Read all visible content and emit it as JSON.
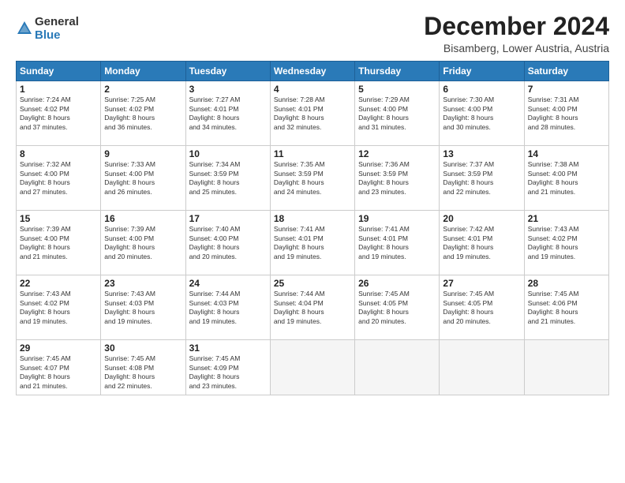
{
  "logo": {
    "general": "General",
    "blue": "Blue"
  },
  "title": "December 2024",
  "location": "Bisamberg, Lower Austria, Austria",
  "days_of_week": [
    "Sunday",
    "Monday",
    "Tuesday",
    "Wednesday",
    "Thursday",
    "Friday",
    "Saturday"
  ],
  "weeks": [
    [
      {
        "day": "1",
        "info": "Sunrise: 7:24 AM\nSunset: 4:02 PM\nDaylight: 8 hours\nand 37 minutes."
      },
      {
        "day": "2",
        "info": "Sunrise: 7:25 AM\nSunset: 4:02 PM\nDaylight: 8 hours\nand 36 minutes."
      },
      {
        "day": "3",
        "info": "Sunrise: 7:27 AM\nSunset: 4:01 PM\nDaylight: 8 hours\nand 34 minutes."
      },
      {
        "day": "4",
        "info": "Sunrise: 7:28 AM\nSunset: 4:01 PM\nDaylight: 8 hours\nand 32 minutes."
      },
      {
        "day": "5",
        "info": "Sunrise: 7:29 AM\nSunset: 4:00 PM\nDaylight: 8 hours\nand 31 minutes."
      },
      {
        "day": "6",
        "info": "Sunrise: 7:30 AM\nSunset: 4:00 PM\nDaylight: 8 hours\nand 30 minutes."
      },
      {
        "day": "7",
        "info": "Sunrise: 7:31 AM\nSunset: 4:00 PM\nDaylight: 8 hours\nand 28 minutes."
      }
    ],
    [
      {
        "day": "8",
        "info": "Sunrise: 7:32 AM\nSunset: 4:00 PM\nDaylight: 8 hours\nand 27 minutes."
      },
      {
        "day": "9",
        "info": "Sunrise: 7:33 AM\nSunset: 4:00 PM\nDaylight: 8 hours\nand 26 minutes."
      },
      {
        "day": "10",
        "info": "Sunrise: 7:34 AM\nSunset: 3:59 PM\nDaylight: 8 hours\nand 25 minutes."
      },
      {
        "day": "11",
        "info": "Sunrise: 7:35 AM\nSunset: 3:59 PM\nDaylight: 8 hours\nand 24 minutes."
      },
      {
        "day": "12",
        "info": "Sunrise: 7:36 AM\nSunset: 3:59 PM\nDaylight: 8 hours\nand 23 minutes."
      },
      {
        "day": "13",
        "info": "Sunrise: 7:37 AM\nSunset: 3:59 PM\nDaylight: 8 hours\nand 22 minutes."
      },
      {
        "day": "14",
        "info": "Sunrise: 7:38 AM\nSunset: 4:00 PM\nDaylight: 8 hours\nand 21 minutes."
      }
    ],
    [
      {
        "day": "15",
        "info": "Sunrise: 7:39 AM\nSunset: 4:00 PM\nDaylight: 8 hours\nand 21 minutes."
      },
      {
        "day": "16",
        "info": "Sunrise: 7:39 AM\nSunset: 4:00 PM\nDaylight: 8 hours\nand 20 minutes."
      },
      {
        "day": "17",
        "info": "Sunrise: 7:40 AM\nSunset: 4:00 PM\nDaylight: 8 hours\nand 20 minutes."
      },
      {
        "day": "18",
        "info": "Sunrise: 7:41 AM\nSunset: 4:01 PM\nDaylight: 8 hours\nand 19 minutes."
      },
      {
        "day": "19",
        "info": "Sunrise: 7:41 AM\nSunset: 4:01 PM\nDaylight: 8 hours\nand 19 minutes."
      },
      {
        "day": "20",
        "info": "Sunrise: 7:42 AM\nSunset: 4:01 PM\nDaylight: 8 hours\nand 19 minutes."
      },
      {
        "day": "21",
        "info": "Sunrise: 7:43 AM\nSunset: 4:02 PM\nDaylight: 8 hours\nand 19 minutes."
      }
    ],
    [
      {
        "day": "22",
        "info": "Sunrise: 7:43 AM\nSunset: 4:02 PM\nDaylight: 8 hours\nand 19 minutes."
      },
      {
        "day": "23",
        "info": "Sunrise: 7:43 AM\nSunset: 4:03 PM\nDaylight: 8 hours\nand 19 minutes."
      },
      {
        "day": "24",
        "info": "Sunrise: 7:44 AM\nSunset: 4:03 PM\nDaylight: 8 hours\nand 19 minutes."
      },
      {
        "day": "25",
        "info": "Sunrise: 7:44 AM\nSunset: 4:04 PM\nDaylight: 8 hours\nand 19 minutes."
      },
      {
        "day": "26",
        "info": "Sunrise: 7:45 AM\nSunset: 4:05 PM\nDaylight: 8 hours\nand 20 minutes."
      },
      {
        "day": "27",
        "info": "Sunrise: 7:45 AM\nSunset: 4:05 PM\nDaylight: 8 hours\nand 20 minutes."
      },
      {
        "day": "28",
        "info": "Sunrise: 7:45 AM\nSunset: 4:06 PM\nDaylight: 8 hours\nand 21 minutes."
      }
    ],
    [
      {
        "day": "29",
        "info": "Sunrise: 7:45 AM\nSunset: 4:07 PM\nDaylight: 8 hours\nand 21 minutes."
      },
      {
        "day": "30",
        "info": "Sunrise: 7:45 AM\nSunset: 4:08 PM\nDaylight: 8 hours\nand 22 minutes."
      },
      {
        "day": "31",
        "info": "Sunrise: 7:45 AM\nSunset: 4:09 PM\nDaylight: 8 hours\nand 23 minutes."
      },
      null,
      null,
      null,
      null
    ]
  ]
}
